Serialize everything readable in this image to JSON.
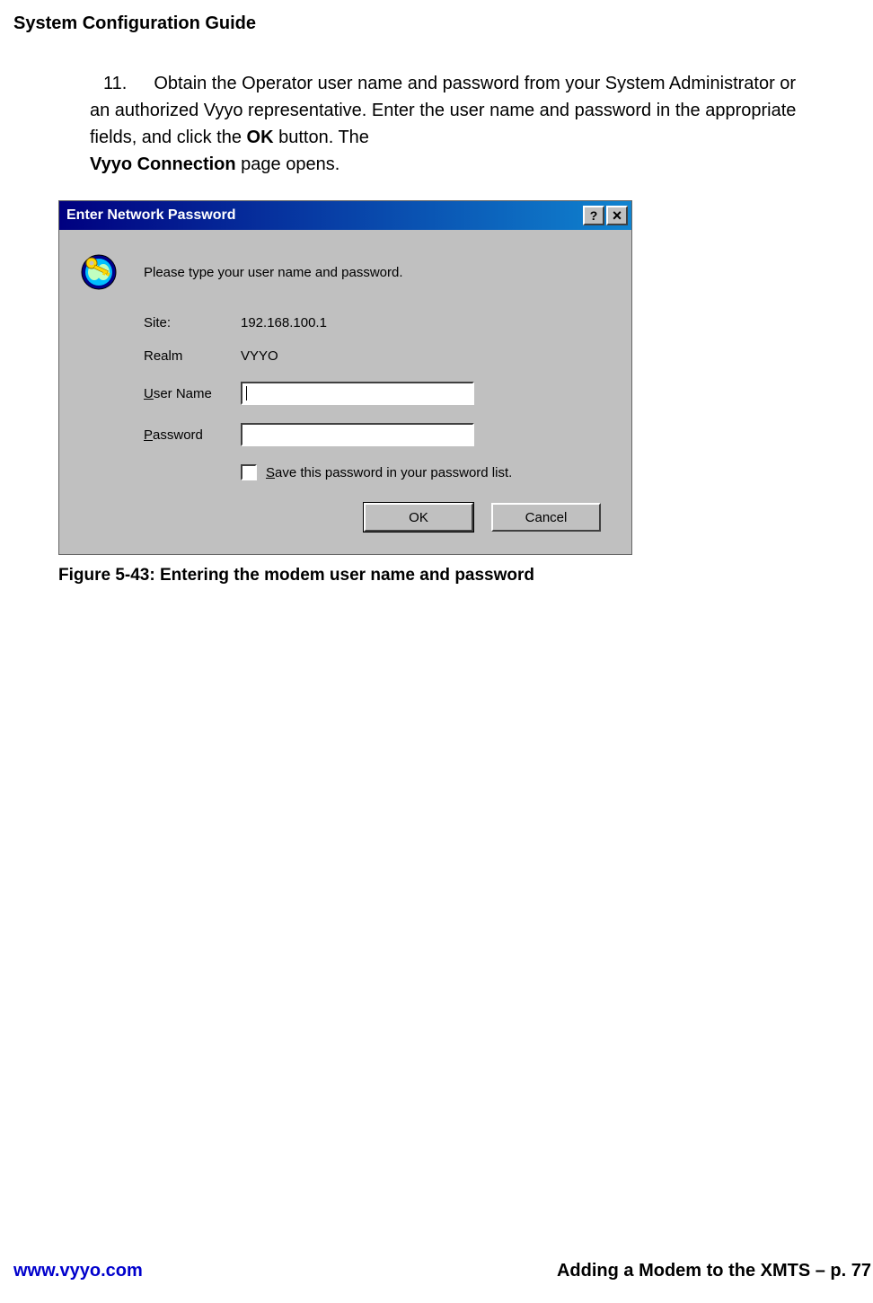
{
  "header": {
    "title": "System Configuration Guide"
  },
  "step": {
    "number": "11.",
    "text_before_bold1": "Obtain the Operator user name and password from your System Administrator or an authorized Vyyo representative. Enter the user name and password in the appropriate fields, and click the ",
    "bold1": "OK",
    "text_middle": " button. The ",
    "bold2": "Vyyo Connection",
    "text_after": " page opens."
  },
  "dialog": {
    "title": "Enter Network Password",
    "help_btn": "?",
    "close_btn": "×",
    "prompt": "Please type your user name and password.",
    "site_label": "Site:",
    "site_value": "192.168.100.1",
    "realm_label": "Realm",
    "realm_value": "VYYO",
    "username_u": "U",
    "username_rest": "ser Name",
    "password_u": "P",
    "password_rest": "assword",
    "checkbox_u": "S",
    "checkbox_rest": "ave this password in your password list.",
    "ok_label": "OK",
    "cancel_label": "Cancel",
    "username_value": "",
    "password_value": ""
  },
  "caption": "Figure 5-43: Entering the modem user name and password",
  "footer": {
    "url": "www.vyyo.com",
    "section": "Adding a Modem to the XMTS – p. 77"
  }
}
